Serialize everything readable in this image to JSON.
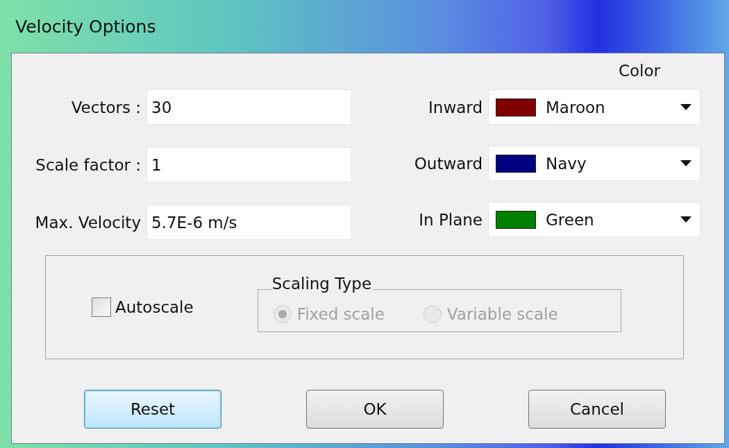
{
  "window": {
    "title": "Velocity Options"
  },
  "fields": [
    {
      "label": "Vectors :",
      "value": "30"
    },
    {
      "label": "Scale factor :",
      "value": "1"
    },
    {
      "label": "Max. Velocity",
      "value": "5.7E-6 m/s"
    }
  ],
  "color_heading": "Color",
  "colors": [
    {
      "label": "Inward",
      "value": "Maroon",
      "color": "#800000"
    },
    {
      "label": "Outward",
      "value": "Navy",
      "color": "#000080"
    },
    {
      "label": "In Plane",
      "value": "Green",
      "color": "#008000"
    }
  ],
  "autoscale": {
    "label": "Autoscale",
    "checked": false
  },
  "scaling_type": {
    "title": "Scaling Type",
    "disabled": true,
    "options": [
      {
        "label": "Fixed scale",
        "selected": true
      },
      {
        "label": "Variable scale",
        "selected": false
      }
    ]
  },
  "buttons": [
    {
      "label": "Reset",
      "focused": true
    },
    {
      "label": "OK",
      "focused": false
    },
    {
      "label": "Cancel",
      "focused": false
    }
  ]
}
